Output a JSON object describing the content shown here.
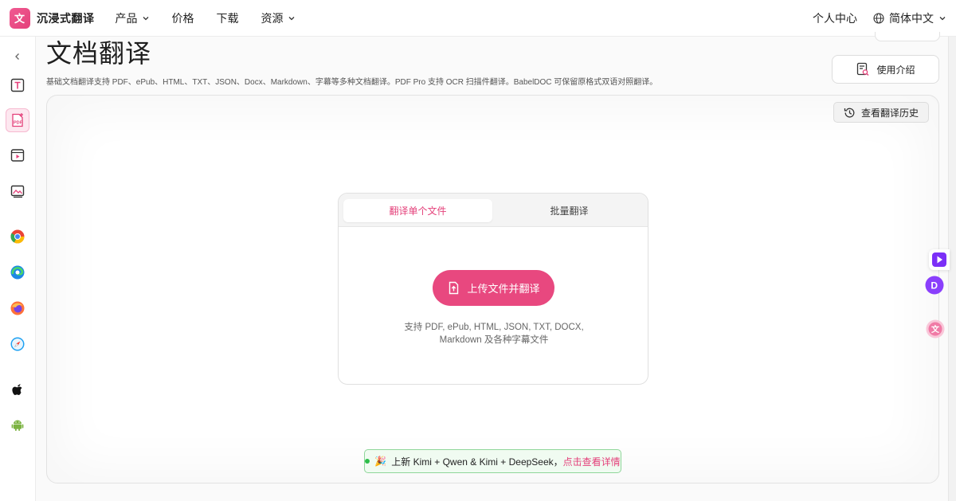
{
  "nav": {
    "brand": "沉浸式翻译",
    "items": [
      {
        "label": "产品",
        "has_dropdown": true
      },
      {
        "label": "价格",
        "has_dropdown": false
      },
      {
        "label": "下载",
        "has_dropdown": false
      },
      {
        "label": "资源",
        "has_dropdown": true
      }
    ],
    "user_center": "个人中心",
    "language": "简体中文"
  },
  "sidebar": {
    "icons": [
      "collapse-icon",
      "text-translate-icon",
      "pdf-translate-icon",
      "video-translate-icon",
      "image-translate-icon",
      "chrome-icon",
      "edge-icon",
      "firefox-icon",
      "safari-icon",
      "apple-icon",
      "android-icon"
    ],
    "active": "pdf-translate-icon"
  },
  "page": {
    "title": "文档翻译",
    "subtitle": "基础文档翻译支持 PDF、ePub、HTML、TXT、JSON、Docx、Markdown、字幕等多种文档翻译。PDF Pro 支持 OCR 扫描件翻译。BabelDOC 可保留原格式双语对照翻译。",
    "intro_button": "使用介绍",
    "history_button": "查看翻译历史"
  },
  "upload_card": {
    "tabs": [
      "翻译单个文件",
      "批量翻译"
    ],
    "active_tab": "翻译单个文件",
    "upload_button": "上传文件并翻译",
    "support_line1": "支持 PDF, ePub, HTML, JSON, TXT, DOCX,",
    "support_line2": "Markdown 及各种字幕文件"
  },
  "banner": {
    "emoji": "🎉",
    "text": "上新 Kimi + Qwen & Kimi + DeepSeek，",
    "link": "点击查看详情"
  },
  "colors": {
    "accent": "#e8487f",
    "banner_bg": "#f0fbf1",
    "banner_border": "#8fd69a"
  }
}
